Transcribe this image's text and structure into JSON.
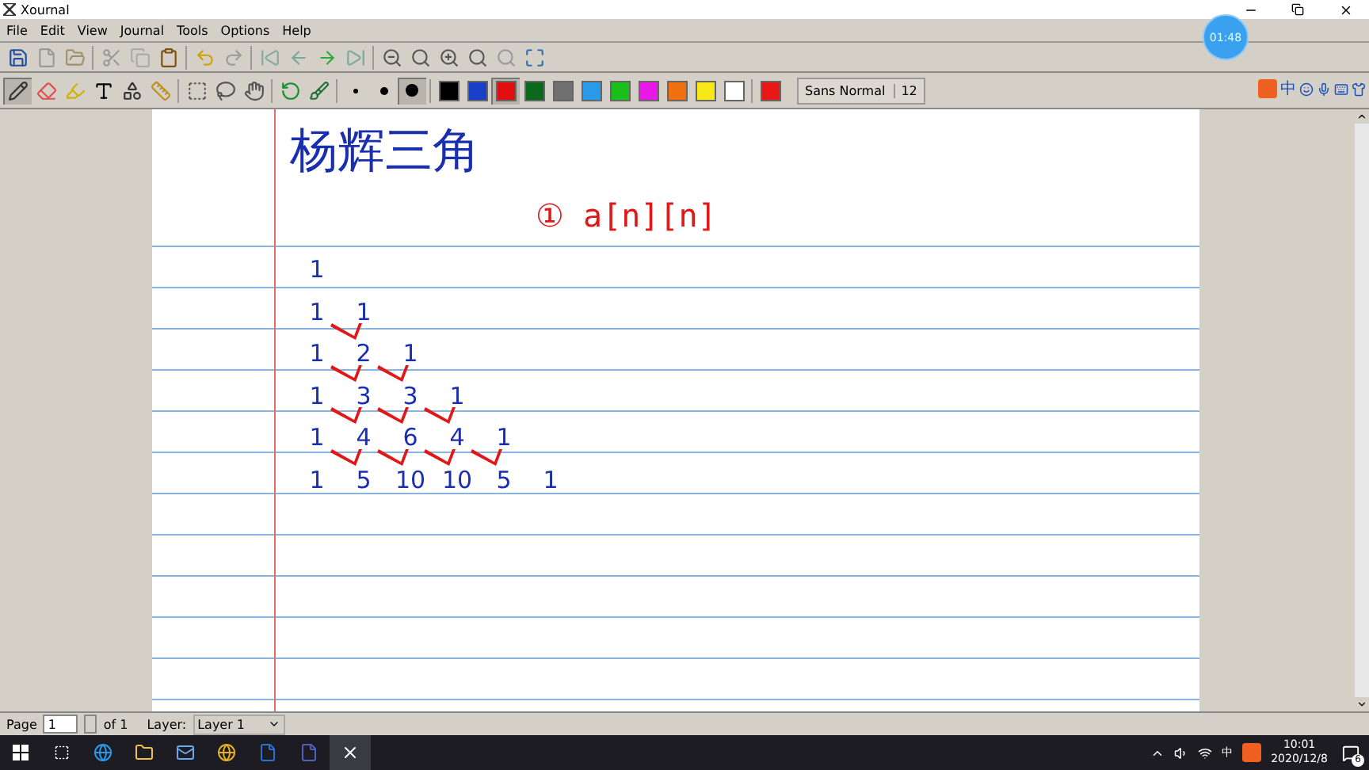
{
  "window": {
    "title": "Xournal"
  },
  "menu": [
    "File",
    "Edit",
    "View",
    "Journal",
    "Tools",
    "Options",
    "Help"
  ],
  "tools": [
    {
      "kind": "pen",
      "selected": true
    },
    {
      "kind": "eraser",
      "selected": false
    },
    {
      "kind": "highlighter",
      "selected": false
    },
    {
      "kind": "text",
      "selected": false
    },
    {
      "kind": "shape",
      "selected": false
    },
    {
      "kind": "ruler",
      "selected": false
    }
  ],
  "pen_widths": [
    {
      "selected": false
    },
    {
      "selected": false
    },
    {
      "selected": true
    }
  ],
  "colors": [
    {
      "color": "#000000",
      "selected": false
    },
    {
      "color": "#1a3fc8",
      "selected": false
    },
    {
      "color": "#e01010",
      "selected": true
    },
    {
      "color": "#0a6a1a",
      "selected": false
    },
    {
      "color": "#707070",
      "selected": false
    },
    {
      "color": "#2a9ae8",
      "selected": false
    },
    {
      "color": "#18c018",
      "selected": false
    },
    {
      "color": "#e818e8",
      "selected": false
    },
    {
      "color": "#f07010",
      "selected": false
    },
    {
      "color": "#f8e818",
      "selected": false
    },
    {
      "color": "#ffffff",
      "selected": false
    }
  ],
  "current_color": {
    "color": "#e81818"
  },
  "font": {
    "name": "Sans Normal",
    "size": "12"
  },
  "recorder": {
    "time": "01:48"
  },
  "ime_bar": {
    "label": "中"
  },
  "page": {
    "title": "杨辉三角",
    "formula": "① a[n][n]",
    "triangle": [
      [
        "1"
      ],
      [
        "1",
        "1"
      ],
      [
        "1",
        "2",
        "1"
      ],
      [
        "1",
        "3",
        "3",
        "1"
      ],
      [
        "1",
        "4",
        "6",
        "4",
        "1"
      ],
      [
        "1",
        "5",
        "10",
        "10",
        "5",
        "1"
      ]
    ]
  },
  "status_bar": {
    "page_label": "Page",
    "page_value": "1",
    "page_total": "of 1",
    "layer_label": "Layer:",
    "layer": "Layer 1"
  },
  "taskbar": {
    "tray_ime": "中",
    "time": "10:01",
    "date": "2020/12/8",
    "notifications": "6"
  }
}
